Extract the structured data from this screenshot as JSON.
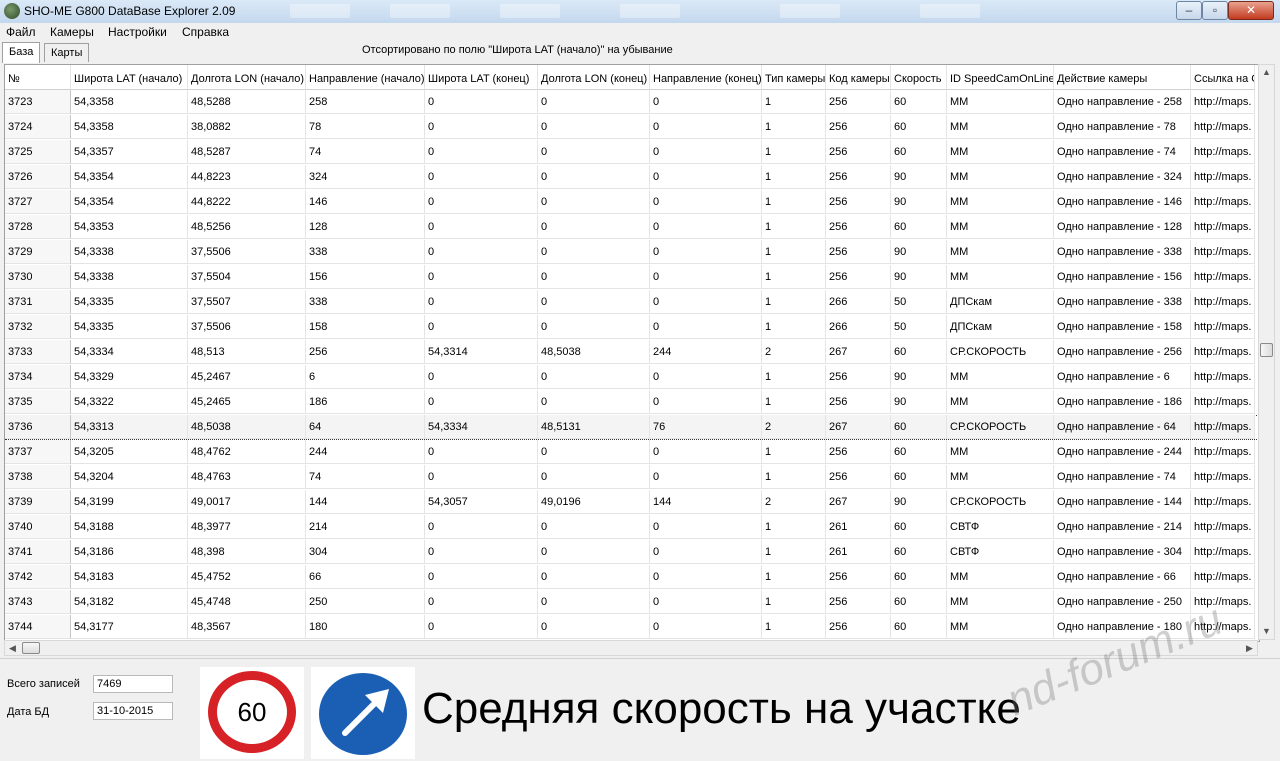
{
  "window": {
    "title": "SHO-ME G800 DataBase Explorer 2.09"
  },
  "menu": [
    "Файл",
    "Камеры",
    "Настройки",
    "Справка"
  ],
  "tabs": [
    "База",
    "Карты"
  ],
  "sort_info": "Отсортировано по полю \"Широта LAT (начало)\" на убывание",
  "columns": [
    "№",
    "Широта LAT (начало)",
    "Долгота LON (начало)",
    "Направление (начало)",
    "Широта LAT (конец)",
    "Долгота LON (конец)",
    "Направление (конец)",
    "Тип камеры",
    "Код камеры",
    "Скорость",
    "ID SpeedCamOnLine",
    "Действие камеры",
    "Ссылка на G"
  ],
  "rows": [
    [
      "3723",
      "54,3358",
      "48,5288",
      "258",
      "0",
      "0",
      "0",
      "1",
      "256",
      "60",
      "MM",
      "Одно направление - 258",
      "http://maps."
    ],
    [
      "3724",
      "54,3358",
      "38,0882",
      "78",
      "0",
      "0",
      "0",
      "1",
      "256",
      "60",
      "MM",
      "Одно направление - 78",
      "http://maps."
    ],
    [
      "3725",
      "54,3357",
      "48,5287",
      "74",
      "0",
      "0",
      "0",
      "1",
      "256",
      "60",
      "MM",
      "Одно направление - 74",
      "http://maps."
    ],
    [
      "3726",
      "54,3354",
      "44,8223",
      "324",
      "0",
      "0",
      "0",
      "1",
      "256",
      "90",
      "MM",
      "Одно направление - 324",
      "http://maps."
    ],
    [
      "3727",
      "54,3354",
      "44,8222",
      "146",
      "0",
      "0",
      "0",
      "1",
      "256",
      "90",
      "MM",
      "Одно направление - 146",
      "http://maps."
    ],
    [
      "3728",
      "54,3353",
      "48,5256",
      "128",
      "0",
      "0",
      "0",
      "1",
      "256",
      "60",
      "MM",
      "Одно направление - 128",
      "http://maps."
    ],
    [
      "3729",
      "54,3338",
      "37,5506",
      "338",
      "0",
      "0",
      "0",
      "1",
      "256",
      "90",
      "MM",
      "Одно направление - 338",
      "http://maps."
    ],
    [
      "3730",
      "54,3338",
      "37,5504",
      "156",
      "0",
      "0",
      "0",
      "1",
      "256",
      "90",
      "MM",
      "Одно направление - 156",
      "http://maps."
    ],
    [
      "3731",
      "54,3335",
      "37,5507",
      "338",
      "0",
      "0",
      "0",
      "1",
      "266",
      "50",
      "ДПСкам",
      "Одно направление - 338",
      "http://maps."
    ],
    [
      "3732",
      "54,3335",
      "37,5506",
      "158",
      "0",
      "0",
      "0",
      "1",
      "266",
      "50",
      "ДПСкам",
      "Одно направление - 158",
      "http://maps."
    ],
    [
      "3733",
      "54,3334",
      "48,513",
      "256",
      "54,3314",
      "48,5038",
      "244",
      "2",
      "267",
      "60",
      "СР.СКОРОСТЬ",
      "Одно направление - 256",
      "http://maps."
    ],
    [
      "3734",
      "54,3329",
      "45,2467",
      "6",
      "0",
      "0",
      "0",
      "1",
      "256",
      "90",
      "MM",
      "Одно направление - 6",
      "http://maps."
    ],
    [
      "3735",
      "54,3322",
      "45,2465",
      "186",
      "0",
      "0",
      "0",
      "1",
      "256",
      "90",
      "MM",
      "Одно направление - 186",
      "http://maps."
    ],
    [
      "3736",
      "54,3313",
      "48,5038",
      "64",
      "54,3334",
      "48,5131",
      "76",
      "2",
      "267",
      "60",
      "СР.СКОРОСТЬ",
      "Одно направление - 64",
      "http://maps."
    ],
    [
      "3737",
      "54,3205",
      "48,4762",
      "244",
      "0",
      "0",
      "0",
      "1",
      "256",
      "60",
      "MM",
      "Одно направление - 244",
      "http://maps."
    ],
    [
      "3738",
      "54,3204",
      "48,4763",
      "74",
      "0",
      "0",
      "0",
      "1",
      "256",
      "60",
      "MM",
      "Одно направление - 74",
      "http://maps."
    ],
    [
      "3739",
      "54,3199",
      "49,0017",
      "144",
      "54,3057",
      "49,0196",
      "144",
      "2",
      "267",
      "90",
      "СР.СКОРОСТЬ",
      "Одно направление - 144",
      "http://maps."
    ],
    [
      "3740",
      "54,3188",
      "48,3977",
      "214",
      "0",
      "0",
      "0",
      "1",
      "261",
      "60",
      "СВТФ",
      "Одно направление - 214",
      "http://maps."
    ],
    [
      "3741",
      "54,3186",
      "48,398",
      "304",
      "0",
      "0",
      "0",
      "1",
      "261",
      "60",
      "СВТФ",
      "Одно направление - 304",
      "http://maps."
    ],
    [
      "3742",
      "54,3183",
      "45,4752",
      "66",
      "0",
      "0",
      "0",
      "1",
      "256",
      "60",
      "MM",
      "Одно направление - 66",
      "http://maps."
    ],
    [
      "3743",
      "54,3182",
      "45,4748",
      "250",
      "0",
      "0",
      "0",
      "1",
      "256",
      "60",
      "MM",
      "Одно направление - 250",
      "http://maps."
    ],
    [
      "3744",
      "54,3177",
      "48,3567",
      "180",
      "0",
      "0",
      "0",
      "1",
      "256",
      "60",
      "MM",
      "Одно направление - 180",
      "http://maps."
    ]
  ],
  "selected_row": 13,
  "bottom": {
    "total_label": "Всего записей",
    "total_value": "7469",
    "date_label": "Дата БД",
    "date_value": "31-10-2015",
    "speed_sign_value": "60",
    "caption": "Средняя скорость на участке",
    "watermark": "nd-forum.ru"
  },
  "icons": {
    "app": "camera-app-icon",
    "speed_sign": "speed-limit-sign-icon",
    "direction_sign": "direction-arrow-sign-icon"
  },
  "colors": {
    "speed_sign_ring": "#d62126",
    "direction_sign_bg": "#1a5fb4"
  }
}
